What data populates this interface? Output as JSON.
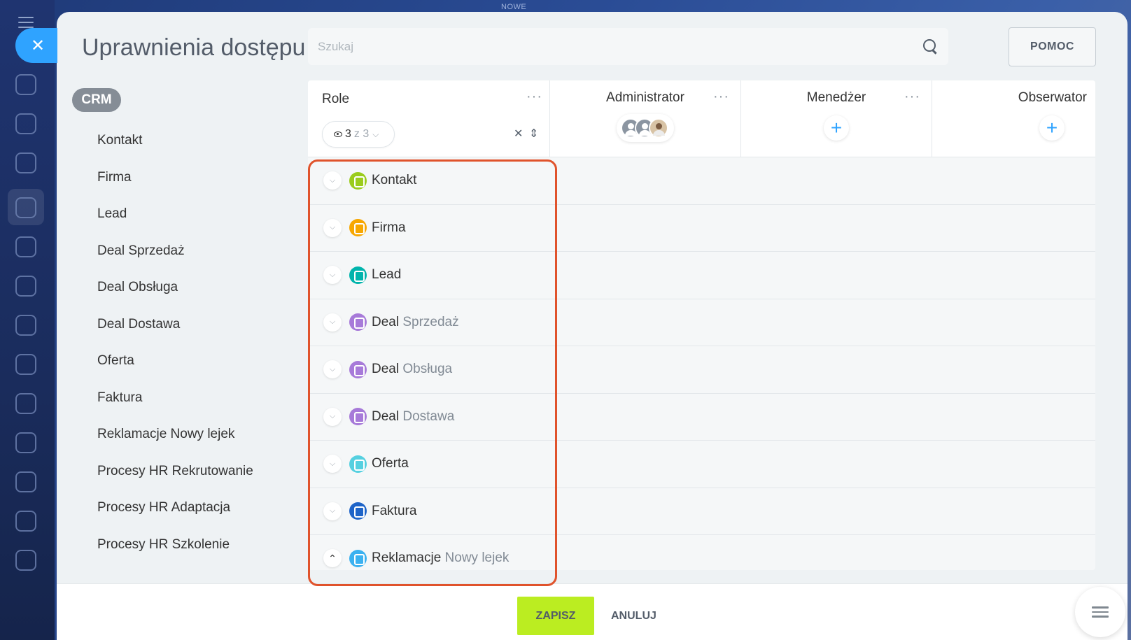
{
  "top_label": "NOWE",
  "header": {
    "title": "Uprawnienia dostępu",
    "search_placeholder": "Szukaj",
    "help_label": "POMOC"
  },
  "sidebar": {
    "section": "CRM",
    "items": [
      "Kontakt",
      "Firma",
      "Lead",
      "Deal Sprzedaż",
      "Deal Obsługa",
      "Deal Dostawa",
      "Oferta",
      "Faktura",
      "Reklamacje Nowy lejek",
      "Procesy HR Rekrutowanie",
      "Procesy HR Adaptacja",
      "Procesy HR Szkolenie"
    ]
  },
  "table": {
    "role_header": "Role",
    "counter": {
      "shown": "3",
      "of": "z 3"
    },
    "roles": [
      {
        "name": "Administrator"
      },
      {
        "name": "Menedżer"
      },
      {
        "name": "Obserwator"
      }
    ],
    "rows": [
      {
        "main": "Kontakt",
        "sub": "",
        "icon": "contact-icon",
        "color": "#9bcc1c",
        "expanded": false
      },
      {
        "main": "Firma",
        "sub": "",
        "icon": "company-icon",
        "color": "#f7a700",
        "expanded": false
      },
      {
        "main": "Lead",
        "sub": "",
        "icon": "lead-icon",
        "color": "#00b4ac",
        "expanded": false
      },
      {
        "main": "Deal",
        "sub": "Sprzedaż",
        "icon": "deal-icon",
        "color": "#a77ad9",
        "expanded": false
      },
      {
        "main": "Deal",
        "sub": "Obsługa",
        "icon": "deal-icon",
        "color": "#a77ad9",
        "expanded": false
      },
      {
        "main": "Deal",
        "sub": "Dostawa",
        "icon": "deal-icon",
        "color": "#a77ad9",
        "expanded": false
      },
      {
        "main": "Oferta",
        "sub": "",
        "icon": "quote-icon",
        "color": "#55d0e0",
        "expanded": false
      },
      {
        "main": "Faktura",
        "sub": "",
        "icon": "invoice-icon",
        "color": "#1e64c8",
        "expanded": false
      },
      {
        "main": "Reklamacje",
        "sub": "Nowy lejek",
        "icon": "smart-process-icon",
        "color": "#3bb1f0",
        "expanded": true
      }
    ]
  },
  "footer": {
    "save_label": "ZAPISZ",
    "cancel_label": "ANULUJ"
  },
  "colors": {
    "accent": "#2fa3ff",
    "save": "#bbed21",
    "highlight": "#e0532c"
  }
}
